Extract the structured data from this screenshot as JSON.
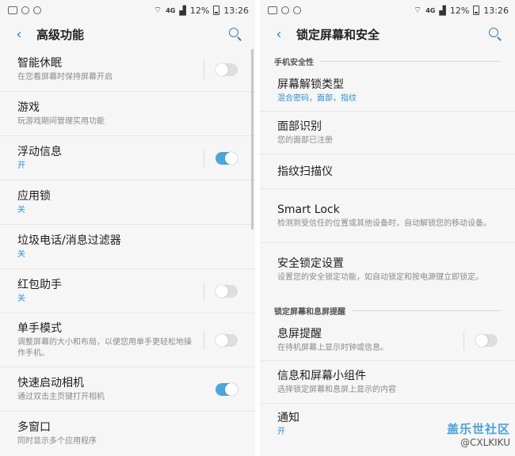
{
  "status": {
    "battery": "12%",
    "time": "13:26",
    "network": "4G"
  },
  "left": {
    "title": "高级功能",
    "items": [
      {
        "label": "智能休眠",
        "sub": "在您看屏幕时保持屏幕开启",
        "toggle": "off"
      },
      {
        "label": "游戏",
        "sub": "玩游戏期间管理实用功能"
      },
      {
        "label": "浮动信息",
        "sub": "开",
        "toggle": "on"
      },
      {
        "label": "应用锁",
        "sub": "关"
      },
      {
        "label": "垃圾电话/消息过滤器",
        "sub": "关"
      },
      {
        "label": "红包助手",
        "sub": "关",
        "toggle": "off"
      },
      {
        "label": "单手模式",
        "sub": "调整屏幕的大小和布局，以便您用单手更轻松地操作手机。",
        "toggle": "off"
      },
      {
        "label": "快速启动相机",
        "sub": "通过双击主页键打开相机",
        "toggle": "on"
      },
      {
        "label": "多窗口",
        "sub": "同时显示多个应用程序"
      }
    ]
  },
  "right": {
    "title": "锁定屏幕和安全",
    "section1": "手机安全性",
    "items1": [
      {
        "label": "屏幕解锁类型",
        "sub": "混合密码，面部，指纹"
      },
      {
        "label": "面部识别",
        "sub": "您的面部已注册"
      },
      {
        "label": "指纹扫描仪",
        "sub": ""
      },
      {
        "label": "Smart Lock",
        "sub": "检测到受信任的位置或其他设备时，自动解锁您的移动设备。"
      },
      {
        "label": "安全锁定设置",
        "sub": "设置您的安全锁定功能，如自动锁定和按电源键立即锁定。"
      }
    ],
    "section2": "锁定屏幕和息屏提醒",
    "items2": [
      {
        "label": "息屏提醒",
        "sub": "在待机屏幕上显示时钟或信息。",
        "toggle": "off"
      },
      {
        "label": "信息和屏幕小组件",
        "sub": "选择锁定屏幕和息屏上显示的内容"
      },
      {
        "label": "通知",
        "sub": "开"
      }
    ]
  },
  "watermark": {
    "main": "盖乐世社区",
    "sub": "@CXLKIKU"
  },
  "colors": {
    "accent": "#4aa7d8",
    "link": "#2f8fd0",
    "background": "#f6f6f6"
  }
}
